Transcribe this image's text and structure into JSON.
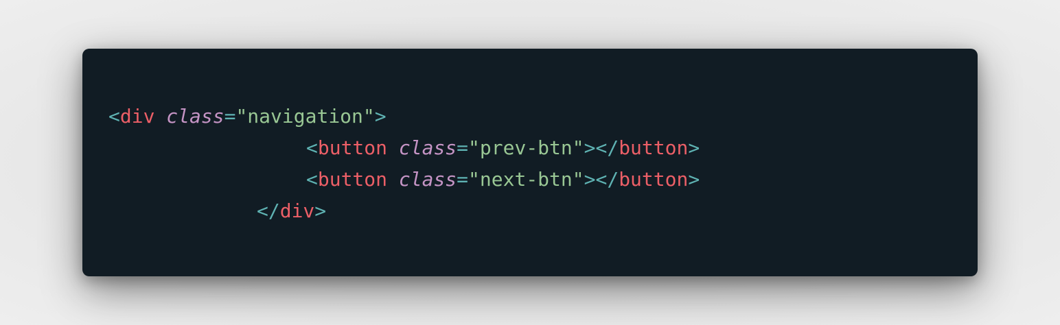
{
  "code": {
    "lines": [
      {
        "indent": "",
        "open": "<",
        "tag": "div",
        "attr": "class",
        "eq": "=",
        "value": "\"navigation\"",
        "close": ">"
      },
      {
        "open": "<",
        "tag": "button",
        "attr": "class",
        "eq": "=",
        "value": "\"prev-btn\"",
        "close": ">",
        "end_open": "</",
        "end_tag": "button",
        "end_close": ">"
      },
      {
        "open": "<",
        "tag": "button",
        "attr": "class",
        "eq": "=",
        "value": "\"next-btn\"",
        "close": ">",
        "end_open": "</",
        "end_tag": "button",
        "end_close": ">"
      },
      {
        "end_open": "</",
        "end_tag": "div",
        "end_close": ">"
      }
    ]
  },
  "colors": {
    "background": "#111c24",
    "punctuation": "#5fb3b3",
    "tag": "#ec5f67",
    "attribute": "#c594c5",
    "string": "#99c794"
  }
}
